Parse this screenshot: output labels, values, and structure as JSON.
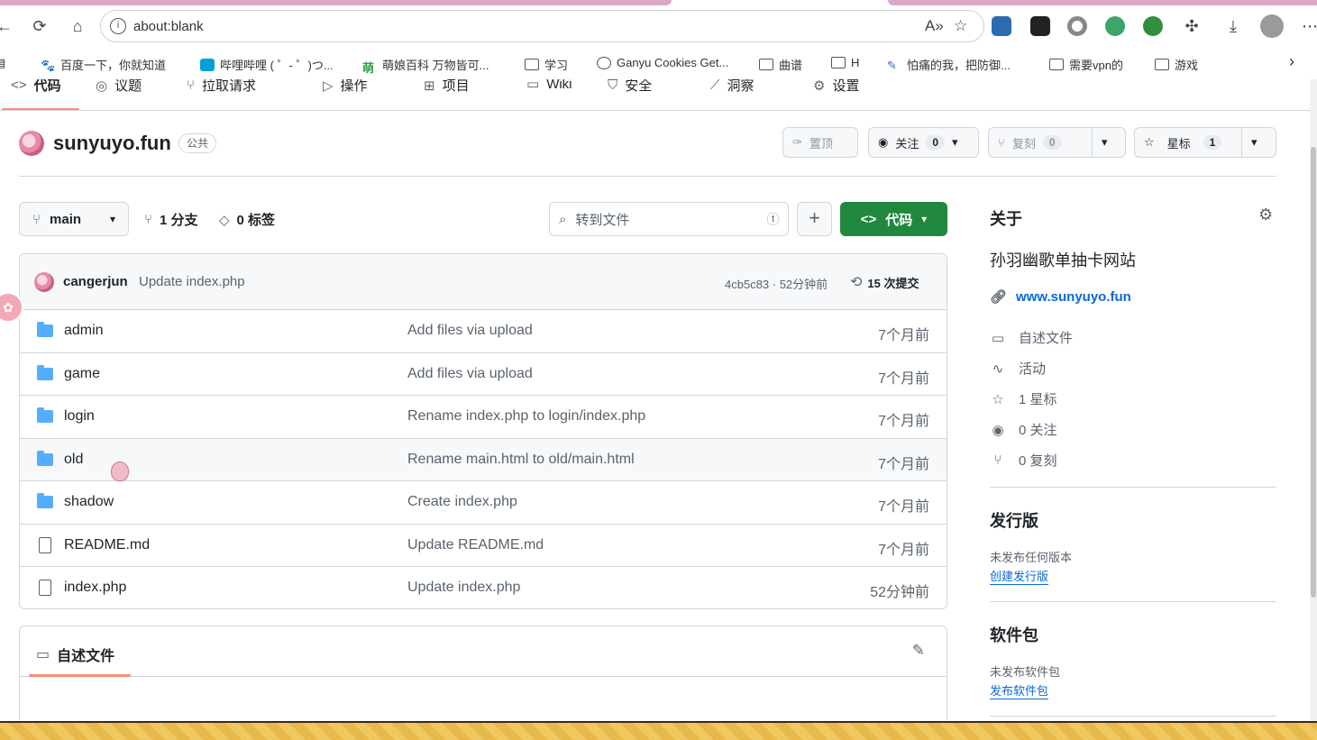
{
  "browser": {
    "url": "about:blank",
    "bookmarks": [
      {
        "label": "百度一下，你就知道"
      },
      {
        "label": "哔哩哔哩 ( ゜- ゜)つ..."
      },
      {
        "label": "萌娘百科 万物皆可..."
      },
      {
        "label": "学习"
      },
      {
        "label": "Ganyu Cookies Get..."
      },
      {
        "label": "曲谱"
      },
      {
        "label": "H"
      },
      {
        "label": "怕痛的我，把防御..."
      },
      {
        "label": "需要vpn的"
      },
      {
        "label": "游戏"
      }
    ]
  },
  "repo_tabs": [
    {
      "label": "代码"
    },
    {
      "label": "议题"
    },
    {
      "label": "拉取请求"
    },
    {
      "label": "操作"
    },
    {
      "label": "项目"
    },
    {
      "label": "Wiki"
    },
    {
      "label": "安全"
    },
    {
      "label": "洞察"
    },
    {
      "label": "设置"
    }
  ],
  "repo": {
    "name": "sunyuyo.fun",
    "visibility": "公共",
    "pin_label": "置顶",
    "watch_label": "关注",
    "watch_count": "0",
    "fork_label": "复刻",
    "fork_count": "0",
    "star_label": "星标",
    "star_count": "1"
  },
  "toolbar": {
    "branch": "main",
    "branches": "1 分支",
    "tags": "0 标签",
    "goto_placeholder": "转到文件",
    "goto_kbd": "t",
    "code_label": "代码"
  },
  "latest_commit": {
    "user": "cangerjun",
    "message": "Update index.php",
    "hash_time": "4cb5c83 · 52分钟前",
    "commits": "15 次提交"
  },
  "files": [
    {
      "name": "admin",
      "type": "dir",
      "message": "Add files via upload",
      "date": "7个月前"
    },
    {
      "name": "game",
      "type": "dir",
      "message": "Add files via upload",
      "date": "7个月前"
    },
    {
      "name": "login",
      "type": "dir",
      "message": "Rename index.php to login/index.php",
      "date": "7个月前"
    },
    {
      "name": "old",
      "type": "dir",
      "message": "Rename main.html to old/main.html",
      "date": "7个月前"
    },
    {
      "name": "shadow",
      "type": "dir",
      "message": "Create index.php",
      "date": "7个月前"
    },
    {
      "name": "README.md",
      "type": "file",
      "message": "Update README.md",
      "date": "7个月前"
    },
    {
      "name": "index.php",
      "type": "file",
      "message": "Update index.php",
      "date": "52分钟前"
    }
  ],
  "readme": {
    "title": "自述文件"
  },
  "sidebar": {
    "about_title": "关于",
    "description": "孙羽幽歌单抽卡网站",
    "website": "www.sunyuyo.fun",
    "items": [
      {
        "label": "自述文件"
      },
      {
        "label": "活动"
      },
      {
        "label": "1 星标"
      },
      {
        "label": "0 关注"
      },
      {
        "label": "0 复刻"
      }
    ],
    "releases_title": "发行版",
    "releases_none": "未发布任何版本",
    "releases_link": "创建发行版",
    "packages_title": "软件包",
    "packages_none": "未发布软件包",
    "packages_link": "发布软件包"
  },
  "colors": {
    "accent_green": "#1f883d",
    "link_blue": "#0969da",
    "tab_underline": "#fd8c73",
    "folder_blue": "#54aeff"
  }
}
